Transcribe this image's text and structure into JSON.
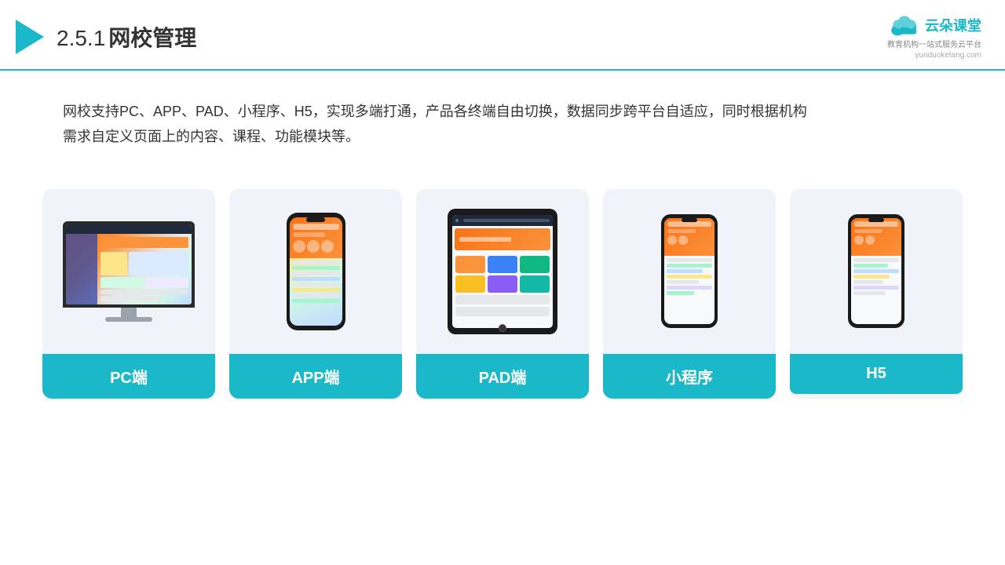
{
  "header": {
    "title_prefix": "2.5.1",
    "title_main": "网校管理",
    "brand_name": "云朵课堂",
    "brand_url": "yunduoketang.com",
    "brand_tagline": "教育机构一站式服务云平台"
  },
  "description": {
    "text1": "网校支持PC、APP、PAD、小程序、H5，实现多端打通，产品各终端自由切换，数据同步跨平台自适应，同时根据机构",
    "text2": "需求自定义页面上的内容、课程、功能模块等。"
  },
  "cards": [
    {
      "label": "PC端",
      "type": "pc"
    },
    {
      "label": "APP端",
      "type": "phone"
    },
    {
      "label": "PAD端",
      "type": "tablet"
    },
    {
      "label": "小程序",
      "type": "phone-small"
    },
    {
      "label": "H5",
      "type": "phone-small2"
    }
  ]
}
